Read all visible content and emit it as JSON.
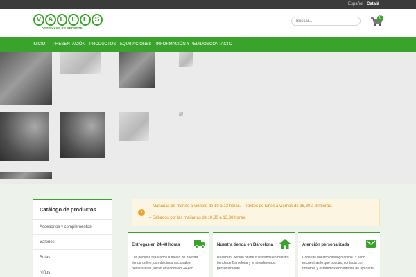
{
  "topbar": {
    "languages": [
      {
        "label": "Español",
        "active": false
      },
      {
        "label": "Català",
        "active": true
      }
    ]
  },
  "header": {
    "logo": {
      "letters": [
        "V",
        "A",
        "L",
        "L",
        "E",
        "S"
      ],
      "subtitle": "ARTÍCULOS DE DEPORTE"
    },
    "search": {
      "placeholder": "Buscar..."
    },
    "cart": {
      "icon": "cart-icon",
      "count": "0"
    }
  },
  "nav": {
    "items": [
      "INICIO",
      "PRESENTACIÓN",
      "PRODUCTOS",
      "EQUIPACIONES",
      "INFORMACIÓN Y PEDIDOS",
      "CONTACTO"
    ]
  },
  "sidebar": {
    "title": "Catálogo de productos",
    "items": [
      "Accesorios y complementos",
      "Balones",
      "Botas",
      "Niños"
    ]
  },
  "notice": {
    "icon": "info-icon",
    "lines": [
      "– Mañanas de martes a viernes de 10 a 13 horas.  – Tardes de lunes a viernes de 16,30 a 20 horas.",
      "– Sábados por las mañanas de 10,30 a 13,30 horas."
    ]
  },
  "cards": [
    {
      "title": "Entregas en 24-48 horas",
      "icon": "truck-icon",
      "text": "Los pedidos realizados a través de nuestra tienda online, con destinos nacionales-peninsulares, serán enviados en 24-48h."
    },
    {
      "title": "Nuestra tienda en Barcelona",
      "icon": "home-icon",
      "text": "Realiza tu pedido online o visítanos en nuestra tienda de Barcelona y te atenderemos personalmente."
    },
    {
      "title": "Atención personalizada",
      "icon": "envelope-icon",
      "text": "Consulta nuestro catálogo online. Y si no encuentras lo que buscas, contacta con nosotros y estaremos encantados de ayudarte."
    }
  ],
  "colors": {
    "brand_green": "#3aa32c",
    "topbar": "#3b3b3b",
    "notice_text": "#d58b16",
    "notice_bg": "#fcf5e1"
  }
}
